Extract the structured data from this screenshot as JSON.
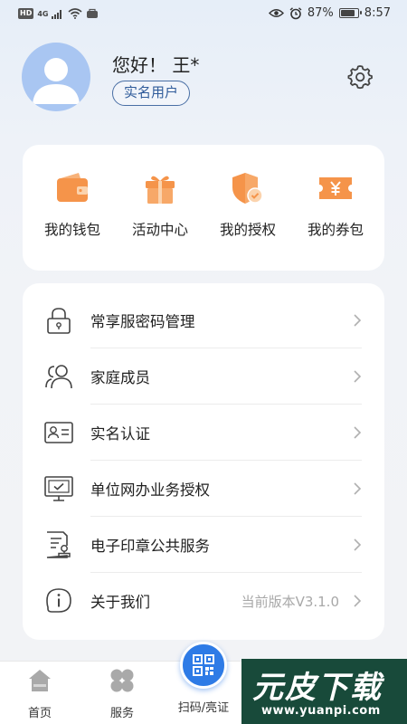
{
  "status_bar": {
    "hd_label": "HD",
    "network": "4G",
    "battery_percent": "87%",
    "battery_level": 0.87,
    "time": "8:57"
  },
  "profile": {
    "greeting": "您好！ 王*",
    "verified_badge": "实名用户"
  },
  "quick_actions": [
    {
      "label": "我的钱包",
      "icon": "wallet-icon"
    },
    {
      "label": "活动中心",
      "icon": "gift-icon"
    },
    {
      "label": "我的授权",
      "icon": "shield-check-icon"
    },
    {
      "label": "我的券包",
      "icon": "coupon-yen-icon"
    }
  ],
  "menu": [
    {
      "label": "常享服密码管理",
      "icon": "lock-icon",
      "value": ""
    },
    {
      "label": "家庭成员",
      "icon": "family-members-icon",
      "value": ""
    },
    {
      "label": "实名认证",
      "icon": "id-card-icon",
      "value": ""
    },
    {
      "label": "单位网办业务授权",
      "icon": "monitor-check-icon",
      "value": ""
    },
    {
      "label": "电子印章公共服务",
      "icon": "document-stamp-icon",
      "value": ""
    },
    {
      "label": "关于我们",
      "icon": "info-bubble-icon",
      "value": "当前版本V3.1.0"
    }
  ],
  "bottom_nav": {
    "home": "首页",
    "services": "服务",
    "scan": "扫码/亮证"
  },
  "watermark": {
    "cn": "元皮下载",
    "url": "www.yuanpi.com"
  },
  "colors": {
    "accent_blue": "#2e7be6",
    "icon_orange": "#f5944a",
    "badge_blue": "#2f5b9a",
    "avatar_blue": "#a9c6f2"
  }
}
